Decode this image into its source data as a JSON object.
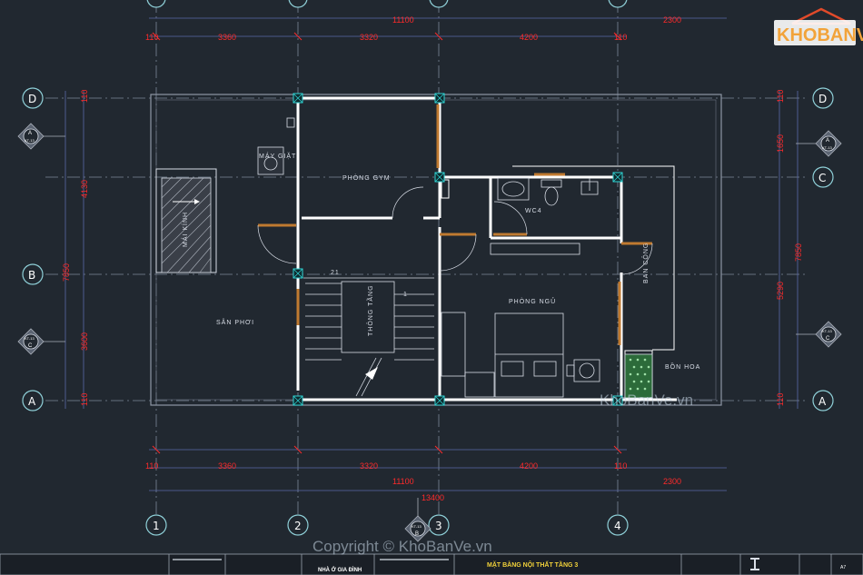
{
  "drawing": {
    "title": "MẶT BẰNG NỘI THẤT TẦNG 3",
    "project": "NHÀ Ở GIA ĐÌNH",
    "sheet_code": "A7"
  },
  "logo": {
    "text": "KHOBANVE"
  },
  "watermarks": {
    "site": "KhoBanVe.vn",
    "copyright": "Copyright © KhoBanVe.vn"
  },
  "axes": {
    "columns": [
      "1",
      "2",
      "3",
      "4"
    ],
    "rows_left": [
      "D",
      "B",
      "A"
    ],
    "rows_right": [
      "D",
      "C",
      "A"
    ]
  },
  "dimensions": {
    "top_total": "11100",
    "top_extra": "2300",
    "top_segments": [
      "110",
      "3360",
      "3320",
      "4200",
      "110"
    ],
    "bottom_segments": [
      "110",
      "3360",
      "3320",
      "4200",
      "110"
    ],
    "bottom_total": "11100",
    "bottom_extra": "2300",
    "bottom_overall": "13400",
    "left_segments": [
      "110",
      "4130",
      "3600",
      "110"
    ],
    "left_total": "7850",
    "right_segments": [
      "110",
      "1650",
      "5290",
      "110"
    ],
    "right_total": "7850",
    "stair_count": "21",
    "stair_start": "1"
  },
  "rooms": {
    "gym": "PHÒNG GYM",
    "wc": "WC4",
    "bedroom": "PHÒNG NGỦ",
    "drying": "SÂN PHƠI",
    "washer": "MÁY GIẶT",
    "skylight": "MÁI KÍNH",
    "void": "THÔNG TẦNG",
    "duct": "BAN CÔNG",
    "planter": "BỒN HOA"
  },
  "section_marks": {
    "left_top": {
      "letter": "A",
      "code": "KT-13"
    },
    "left_bottom": {
      "letter": "C",
      "code": "KT-13"
    },
    "right_top": {
      "letter": "A",
      "code": "KT-13"
    },
    "right_bottom": {
      "letter": "C",
      "code": "KT-13"
    },
    "bottom": {
      "letter": "B",
      "code": "KT-13"
    }
  },
  "colors": {
    "background": "#212830",
    "wall": "#ffffff",
    "dimension": "#ff2a2a",
    "axis_line": "#8a94a6",
    "column": "#2fd3d3",
    "door": "#c07a30"
  }
}
